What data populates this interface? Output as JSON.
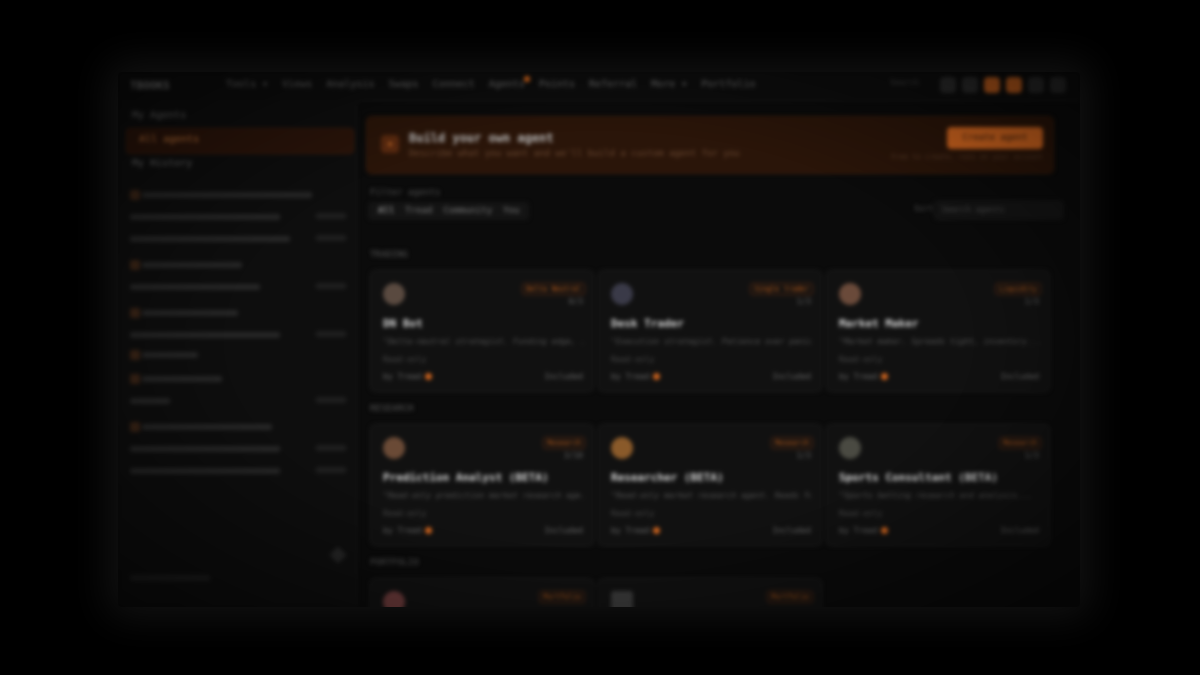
{
  "app": {
    "logo": "TBOOKS",
    "nav": [
      {
        "label": "Tools",
        "caret": true
      },
      {
        "label": "Views"
      },
      {
        "label": "Analysis"
      },
      {
        "label": "Swaps"
      },
      {
        "label": "Connect"
      },
      {
        "label": "Agents",
        "badge": true
      },
      {
        "label": "Points"
      },
      {
        "label": "Referral"
      },
      {
        "label": "More",
        "caret": true
      },
      {
        "label": "Portfolio"
      }
    ],
    "nav_search": "Search"
  },
  "sidebar": {
    "title": "My Agents",
    "active_item": "All agents",
    "subheading": "My History"
  },
  "banner": {
    "title": "Build your own agent",
    "subtitle": "Describe what you want and we'll build a custom agent for you",
    "button": "Create agent",
    "note": "Free to create, runs on your account"
  },
  "filters": {
    "label": "Filter agents",
    "options": [
      "All",
      "Tread",
      "Community",
      "You"
    ],
    "sort": "Sort by: All",
    "search_placeholder": "Search agents"
  },
  "sections": {
    "first": "TRADING",
    "second": "RESEARCH",
    "third": "PORTFOLIO"
  },
  "cards_row1": [
    {
      "name": "DN Bot",
      "tag": "Delta Neutral",
      "count": "0/3",
      "desc": "\"Delta-neutral strategist. Funding edge, ...",
      "access": "Read-only",
      "by": "by Tread",
      "price": "Included"
    },
    {
      "name": "Desk Trader",
      "tag": "Single trader",
      "count": "1/3",
      "desc": "\"Execution strategist. Patience over panic...",
      "access": "Read-only",
      "by": "by Tread",
      "price": "Included"
    },
    {
      "name": "Market Maker",
      "tag": "Liquidity",
      "count": "1/3",
      "desc": "\"Market maker. Spreads tight, inventory...",
      "access": "Read-only",
      "by": "by Tread",
      "price": "Included"
    }
  ],
  "cards_row2": [
    {
      "name": "Prediction Analyst (BETA)",
      "tag": "Research",
      "count": "3/10",
      "desc": "\"Read-only prediction market research age...",
      "access": "Read-only",
      "by": "by Tread",
      "price": "Included"
    },
    {
      "name": "Researcher (BETA)",
      "tag": "Research",
      "count": "1/3",
      "desc": "\"Read-only market research agent. Reads fu...",
      "access": "Read-only",
      "by": "by Tread",
      "price": "Included"
    },
    {
      "name": "Sports Consultant (BETA)",
      "tag": "Research",
      "count": "1/3",
      "desc": "\"Sports betting research and analysis...",
      "access": "Read-only",
      "by": "by Tread",
      "price": "Included"
    }
  ],
  "cards_row3": [
    {
      "tag": "Portfolio"
    },
    {
      "tag": "Portfolio"
    }
  ]
}
